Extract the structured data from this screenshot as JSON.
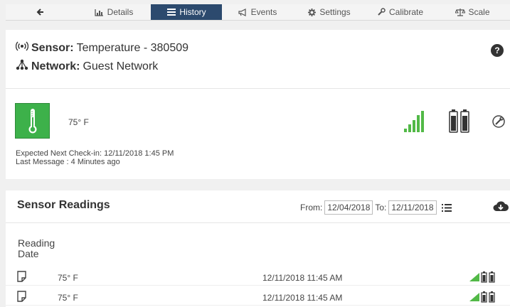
{
  "tabs": {
    "back": "",
    "details": "Details",
    "history": "History",
    "events": "Events",
    "settings": "Settings",
    "calibrate": "Calibrate",
    "scale": "Scale"
  },
  "sensor": {
    "sensor_label": "Sensor:",
    "sensor_name": "Temperature - 380509",
    "network_label": "Network:",
    "network_name": "Guest Network",
    "current_reading": "75° F",
    "next_checkin": "Expected Next Check-in: 12/11/2018 1:45 PM",
    "last_message": "Last Message : 4 Minutes ago"
  },
  "readings": {
    "title": "Sensor Readings",
    "from_label": "From:",
    "from_value": "12/04/2018",
    "to_label": "To:",
    "to_value": "12/11/2018",
    "column_header_line1": "Reading",
    "column_header_line2": "Date",
    "rows": [
      {
        "value": "75° F",
        "date": "12/11/2018 11:45 AM"
      },
      {
        "value": "75° F",
        "date": "12/11/2018 11:45 AM"
      }
    ]
  },
  "colors": {
    "active_tab": "#2c4a6e",
    "status_green": "#3db14a",
    "signal_green": "#52b947"
  }
}
